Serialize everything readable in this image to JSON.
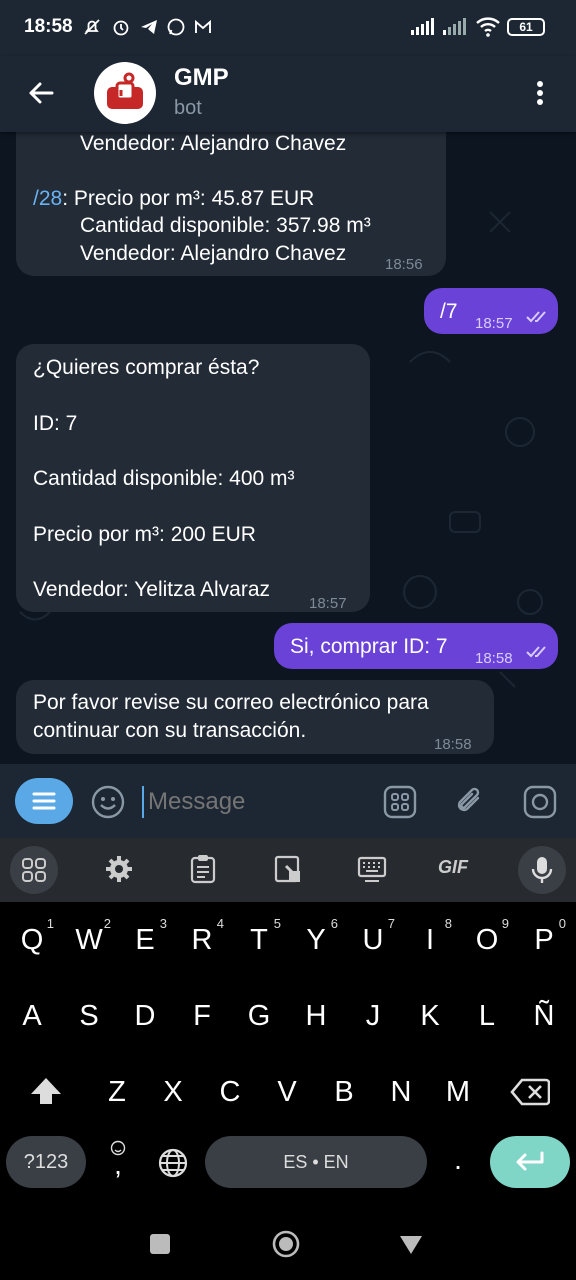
{
  "status": {
    "time": "18:58",
    "battery": "61"
  },
  "header": {
    "title": "GMP",
    "subtitle": "bot"
  },
  "messages": {
    "m1_line1": "Vendedor: Alejandro Chavez",
    "m1_cmd": "/28",
    "m1_line2": ": Precio por m³: 45.87 EUR",
    "m1_line3": "Cantidad disponible: 357.98 m³",
    "m1_line4": "Vendedor: Alejandro Chavez",
    "m1_time": "18:56",
    "m2_text": "/7",
    "m2_time": "18:57",
    "m3_line1": "¿Quieres comprar ésta?",
    "m3_line2": "ID: 7",
    "m3_line3": "Cantidad disponible: 400 m³",
    "m3_line4": "Precio por m³: 200 EUR",
    "m3_line5": "Vendedor: Yelitza Alvaraz",
    "m3_time": "18:57",
    "m4_text": "Si, comprar ID: 7",
    "m4_time": "18:58",
    "m5_line1": "Por favor revise su correo electrónico para",
    "m5_line2": "continuar con su transacción.",
    "m5_time": "18:58"
  },
  "composer": {
    "placeholder": "Message"
  },
  "keyboard": {
    "row1": [
      "Q",
      "W",
      "E",
      "R",
      "T",
      "Y",
      "U",
      "I",
      "O",
      "P"
    ],
    "row1_hints": [
      "1",
      "2",
      "3",
      "4",
      "5",
      "6",
      "7",
      "8",
      "9",
      "0"
    ],
    "row2": [
      "A",
      "S",
      "D",
      "F",
      "G",
      "H",
      "J",
      "K",
      "L",
      "Ñ"
    ],
    "row3": [
      "Z",
      "X",
      "C",
      "V",
      "B",
      "N",
      "M"
    ],
    "sym": "?123",
    "space": "ES • EN",
    "period": ".",
    "comma": ",",
    "gif": "GIF"
  },
  "colors": {
    "accent": "#6a42d8",
    "link": "#6ab3f3",
    "enter": "#7fd6c7",
    "menu": "#5aa9e6"
  }
}
